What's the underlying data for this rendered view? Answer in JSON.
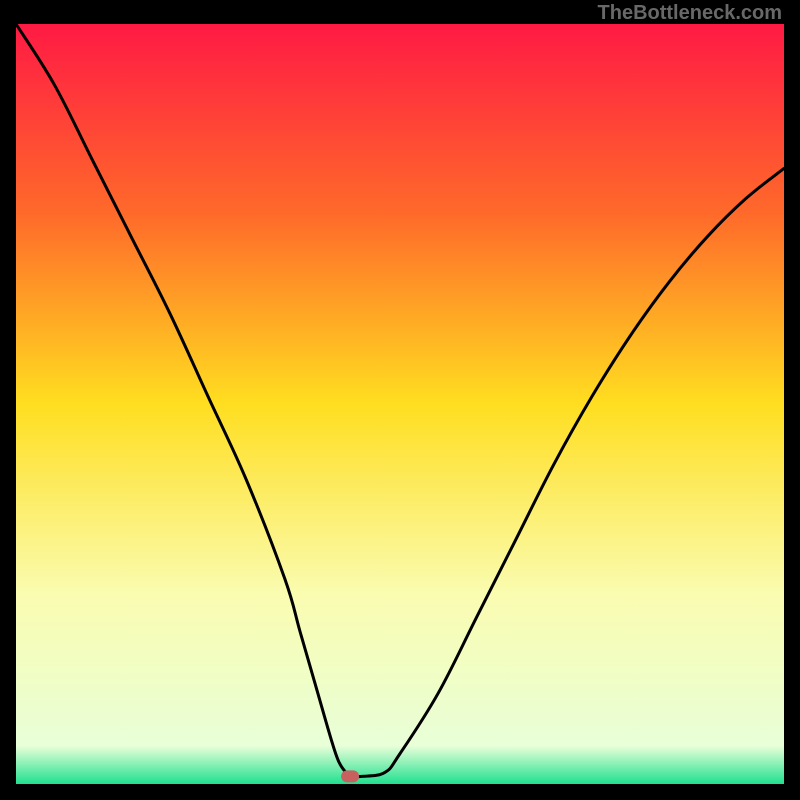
{
  "watermark": "TheBottleneck.com",
  "chart_data": {
    "type": "line",
    "title": "",
    "xlabel": "",
    "ylabel": "",
    "xlim": [
      0,
      100
    ],
    "ylim": [
      0,
      100
    ],
    "x": [
      0,
      5,
      10,
      15,
      20,
      25,
      30,
      35,
      37,
      39,
      41,
      42,
      43,
      44,
      45,
      48,
      50,
      55,
      60,
      65,
      70,
      75,
      80,
      85,
      90,
      95,
      100
    ],
    "values": [
      100,
      92,
      82,
      72,
      62,
      51,
      40,
      27,
      20,
      13,
      6,
      3,
      1.5,
      1,
      1,
      1.5,
      4,
      12,
      22,
      32,
      42,
      51,
      59,
      66,
      72,
      77,
      81
    ],
    "marker": {
      "x": 43.5,
      "y": 1,
      "color": "#c86060"
    },
    "gradient_stops": [
      {
        "offset": 0,
        "color": "#ff1a44"
      },
      {
        "offset": 25,
        "color": "#ff6a2a"
      },
      {
        "offset": 50,
        "color": "#ffde20"
      },
      {
        "offset": 75,
        "color": "#fafcb0"
      },
      {
        "offset": 95,
        "color": "#e8ffd8"
      },
      {
        "offset": 100,
        "color": "#20e090"
      }
    ]
  }
}
